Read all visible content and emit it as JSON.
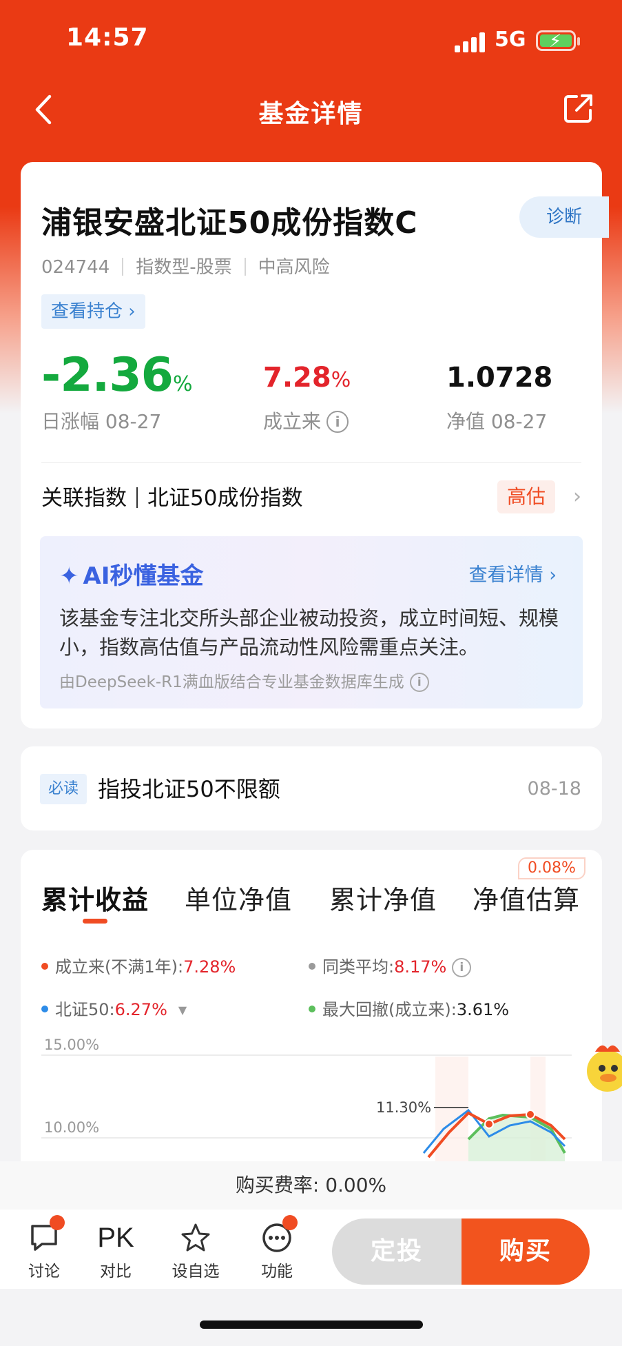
{
  "status": {
    "time": "14:57",
    "network": "5G"
  },
  "nav": {
    "title": "基金详情"
  },
  "fund": {
    "name": "浦银安盛北证50成份指数C",
    "diagnose_label": "诊断",
    "code": "024744",
    "type": "指数型-股票",
    "risk": "中高风险",
    "holdings_label": "查看持仓 ›"
  },
  "stats": {
    "daily_change": "-2.36",
    "daily_change_unit": "%",
    "daily_change_label": "日涨幅 08-27",
    "since_inception": "7.28",
    "since_inception_unit": "%",
    "since_inception_label": "成立来",
    "nav_value": "1.0728",
    "nav_label": "净值 08-27"
  },
  "related": {
    "label": "关联指数",
    "index": "北证50成份指数",
    "valuation": "高估"
  },
  "ai": {
    "title": "AI秒懂基金",
    "more": "查看详情 ›",
    "text": "该基金专注北交所头部企业被动投资，成立时间短、规模小，指数高估值与产品流动性风险需重点关注。",
    "source": "由DeepSeek-R1满血版结合专业基金数据库生成"
  },
  "notice": {
    "tag": "必读",
    "title": "指投北证50不限额",
    "date": "08-18"
  },
  "tabs": [
    "累计收益",
    "单位净值",
    "累计净值",
    "净值估算"
  ],
  "estimate_badge": "0.08%",
  "legend": {
    "fund_label": "成立来(不满1年):",
    "fund_value": "7.28%",
    "peer_label": "同类平均:",
    "peer_value": "8.17%",
    "index_label": "北证50:",
    "index_value": "6.27%",
    "drawdown_label": "最大回撤(成立来):",
    "drawdown_value": "3.61%",
    "colors": {
      "fund": "#f04c23",
      "peer": "#9a9a9a",
      "index": "#2d8ce8",
      "drawdown": "#5cbf5c"
    }
  },
  "chart_data": {
    "type": "line",
    "y_ticks": [
      "15.00%",
      "10.00%"
    ],
    "annotation": "11.30%"
  },
  "fee": {
    "label": "购买费率:",
    "value": "0.00%"
  },
  "bottom_bar": {
    "discuss": "讨论",
    "pk_glyph": "PK",
    "compare": "对比",
    "watchlist": "设自选",
    "functions": "功能",
    "auto_invest": "定投",
    "buy": "购买"
  }
}
